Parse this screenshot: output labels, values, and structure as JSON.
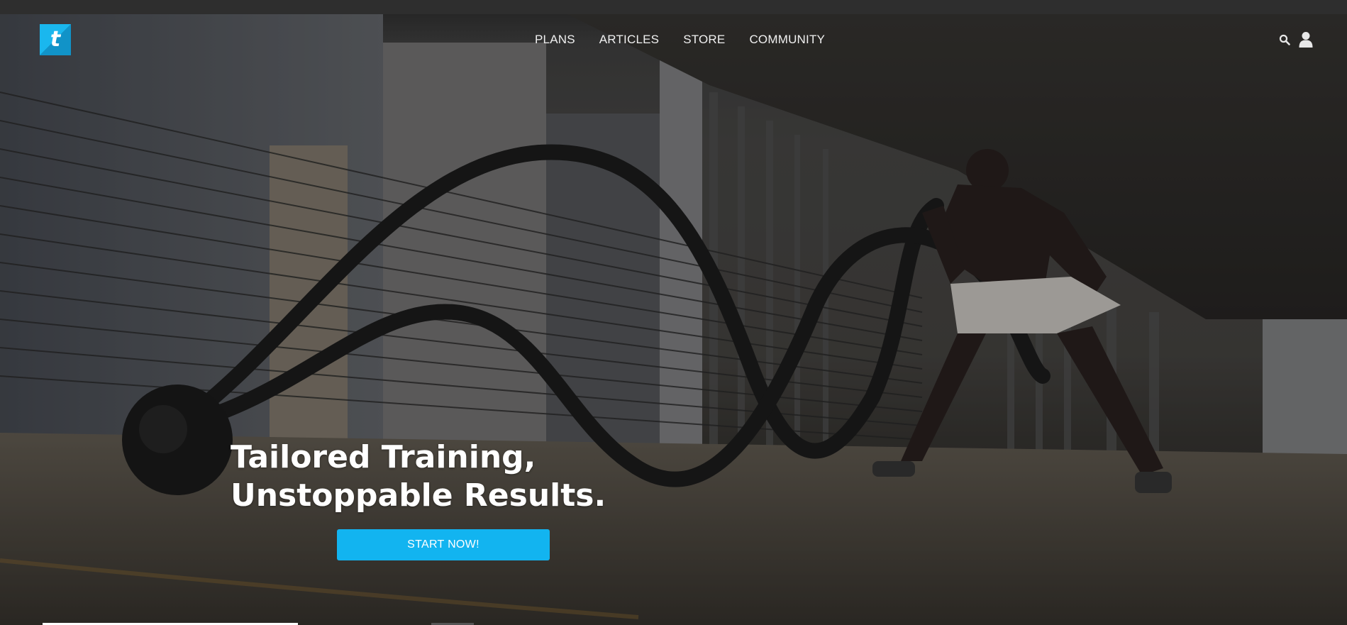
{
  "brand": {
    "logo_letter": "t",
    "accent": "#12b4f0"
  },
  "nav": {
    "items": [
      {
        "label": "PLANS"
      },
      {
        "label": "ARTICLES"
      },
      {
        "label": "STORE"
      },
      {
        "label": "COMMUNITY"
      }
    ]
  },
  "header_icons": [
    "search-icon",
    "user-icon"
  ],
  "hero": {
    "headline_line1": "Tailored Training,",
    "headline_line2": "Unstoppable Results.",
    "cta_label": "START NOW!"
  }
}
